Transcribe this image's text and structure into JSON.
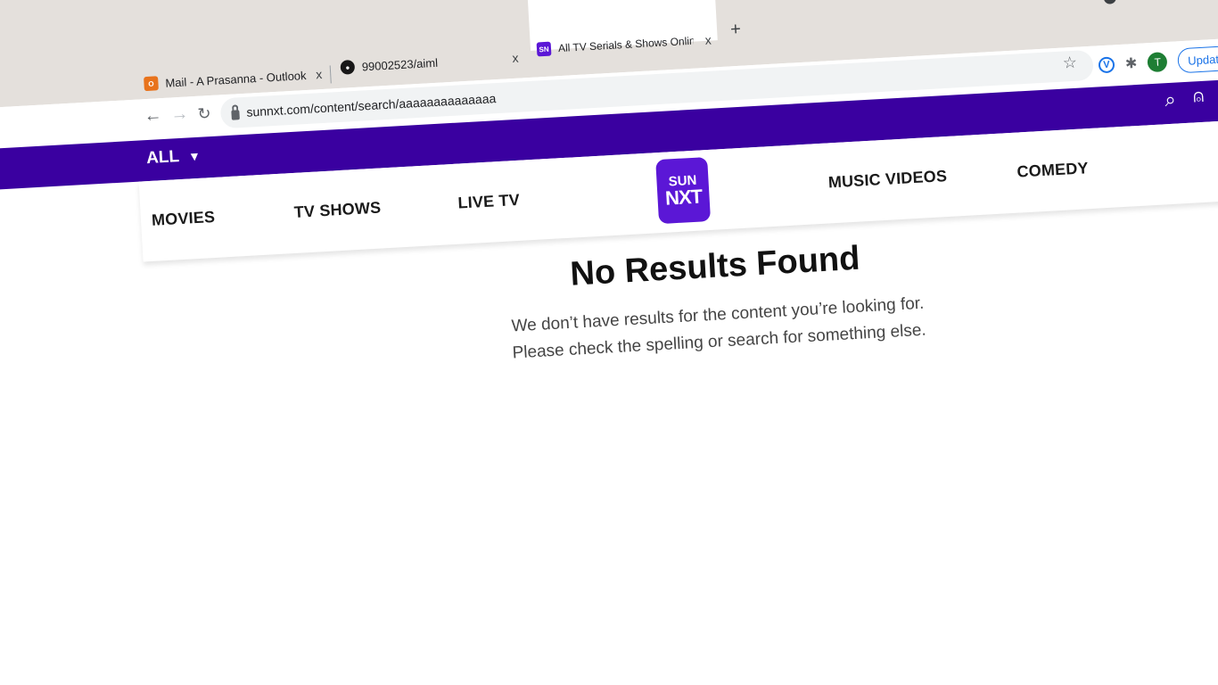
{
  "browser": {
    "tabs": [
      {
        "title": "Mail - A Prasanna - Outlook",
        "favicon": "outlook-icon",
        "color": "#e8731c",
        "active": false
      },
      {
        "title": "99002523/aiml",
        "favicon": "github-icon",
        "color": "#181717",
        "active": false
      },
      {
        "title": "All TV Serials & Shows Online | V",
        "favicon": "sunnxt-icon",
        "color": "#5b17d6",
        "active": true
      }
    ],
    "close_glyph": "x",
    "new_tab_glyph": "+",
    "url": "sunnxt.com/content/search/aaaaaaaaaaaaaa",
    "profile_initial": "T",
    "update_label": "Update"
  },
  "site": {
    "filter_label": "ALL",
    "nav": {
      "movies": "MOVIES",
      "tv_shows": "TV SHOWS",
      "live_tv": "LIVE TV",
      "music_videos": "MUSIC VIDEOS",
      "comedy": "COMEDY"
    },
    "logo": {
      "line1": "SUN",
      "line2": "NXT"
    },
    "brand_color": "#3a00a0"
  },
  "results": {
    "heading": "No Results Found",
    "line1": "We don’t have results for the content you’re looking for.",
    "line2": "Please check the spelling or search for something else."
  }
}
